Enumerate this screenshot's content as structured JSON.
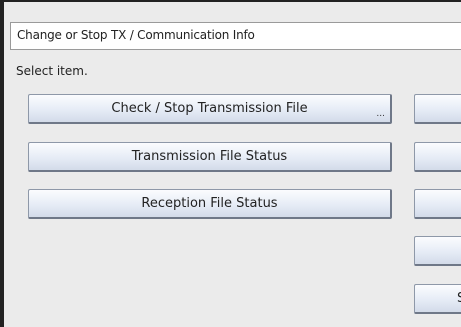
{
  "header": {
    "title": "Change or Stop TX / Communication Info"
  },
  "instruction": "Select item.",
  "menu": {
    "left_buttons": [
      {
        "label": "Check / Stop Transmission File",
        "more": "..."
      },
      {
        "label": "Transmission File Status"
      },
      {
        "label": "Reception File Status"
      }
    ],
    "right_buttons": [
      {
        "label": ""
      },
      {
        "label": ""
      },
      {
        "label": ""
      },
      {
        "label": ""
      },
      {
        "label": "St"
      }
    ]
  }
}
